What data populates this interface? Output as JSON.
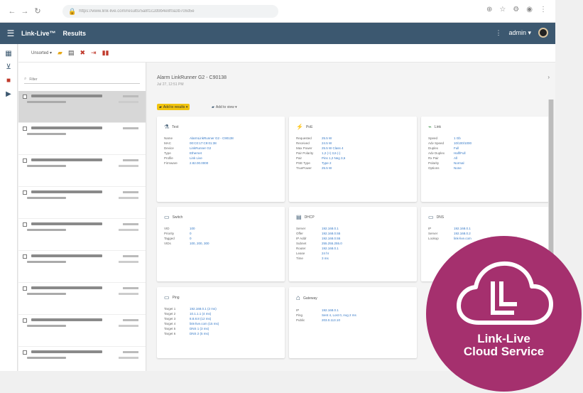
{
  "browser": {
    "back_icon": "arrow-left-icon",
    "forward_icon": "arrow-right-icon",
    "reload_icon": "reload-icon",
    "url": "https://www.link-live.com/results/5a8f1c2d9b4e8f0a3b7c6d5e"
  },
  "app": {
    "brand": "Link-Live™",
    "section": "Results",
    "user": "admin ▾",
    "color_header": "#3c5870"
  },
  "toolbar": {
    "select_label": "Unsorted ▾"
  },
  "list": {
    "search_placeholder": "Filter"
  },
  "detail": {
    "title": "Alarm LinkRunner G2 - C90138",
    "subtitle": "Jul 27, 12:51 PM",
    "chip_primary": "Add to results ▾",
    "chip_secondary": "Add to view ▾"
  },
  "cards": {
    "test": {
      "title": "Test",
      "rows": [
        {
          "k": "Name",
          "v": "AlarmLinkRunner G2 - C90138"
        },
        {
          "k": "MAC",
          "v": "00:C0:17:C9:01:38"
        },
        {
          "k": "Device",
          "v": "LinkRunner G2"
        },
        {
          "k": "Type",
          "v": "Ethernet"
        },
        {
          "k": "Profile",
          "v": "Link Live"
        },
        {
          "k": "Firmware",
          "v": "2.82.00.0000"
        }
      ]
    },
    "poe": {
      "title": "PoE",
      "rows": [
        {
          "k": "Requested",
          "v": "25.5 W"
        },
        {
          "k": "Received",
          "v": "24.5 W"
        },
        {
          "k": "Max Power",
          "v": "25.5 W Class 4"
        },
        {
          "k": "Pair Polarity",
          "v": "1,2 (+) 3,6 (-)"
        },
        {
          "k": "Pair",
          "v": "Pins 1,2 Neg 3,6"
        },
        {
          "k": "PSE Type",
          "v": "Type 2"
        },
        {
          "k": "TruePower",
          "v": "25.5 W"
        }
      ]
    },
    "link": {
      "title": "Link",
      "rows": [
        {
          "k": "Speed",
          "v": "1 Gb"
        },
        {
          "k": "Adv Speed",
          "v": "10/100/1000"
        },
        {
          "k": "Duplex",
          "v": "Full"
        },
        {
          "k": "Adv Duplex",
          "v": "Half/Full"
        },
        {
          "k": "Rx Pair",
          "v": "All"
        },
        {
          "k": "Polarity",
          "v": "Normal"
        },
        {
          "k": "Options",
          "v": "None"
        }
      ]
    },
    "switch": {
      "title": "Switch",
      "rows": [
        {
          "k": "VID",
          "v": "100"
        },
        {
          "k": "Priority",
          "v": "0"
        },
        {
          "k": "Tagged",
          "v": "0"
        },
        {
          "k": "VIDs",
          "v": "100, 200, 300"
        }
      ]
    },
    "dhcp": {
      "title": "DHCP",
      "rows": [
        {
          "k": "Server",
          "v": "192.168.0.1"
        },
        {
          "k": "Offer",
          "v": "192.168.0.55"
        },
        {
          "k": "IP Addr",
          "v": "192.168.0.55"
        },
        {
          "k": "Subnet",
          "v": "255.255.255.0"
        },
        {
          "k": "Router",
          "v": "192.168.0.1"
        },
        {
          "k": "Lease",
          "v": "24 hr"
        },
        {
          "k": "Time",
          "v": "3 ms"
        }
      ]
    },
    "dns": {
      "title": "DNS",
      "rows": [
        {
          "k": "IP",
          "v": "192.168.0.1"
        },
        {
          "k": "Server",
          "v": "192.168.0.2"
        },
        {
          "k": "Lookup",
          "v": "link-live.com"
        }
      ]
    },
    "ping": {
      "title": "Ping",
      "rows": [
        {
          "k": "Target 1",
          "v": "192.168.0.1 (2 ms)"
        },
        {
          "k": "Target 2",
          "v": "10.1.1.1 (4 ms)"
        },
        {
          "k": "Target 3",
          "v": "8.8.8.8 (12 ms)"
        },
        {
          "k": "Target 4",
          "v": "link-live.com (15 ms)"
        },
        {
          "k": "Target 5",
          "v": "DNS 1 (3 ms)"
        },
        {
          "k": "Target 6",
          "v": "DNS 2 (5 ms)"
        }
      ]
    },
    "gateway": {
      "title": "Gateway",
      "rows": [
        {
          "k": "IP",
          "v": "192.168.0.1"
        },
        {
          "k": "Ping",
          "v": "Sent 4, Lost 0, Avg 2 ms"
        },
        {
          "k": "Public",
          "v": "203.0.113.10"
        }
      ]
    }
  },
  "badge": {
    "line1": "Link-Live",
    "line2": "Cloud Service",
    "color": "#a5306e"
  }
}
